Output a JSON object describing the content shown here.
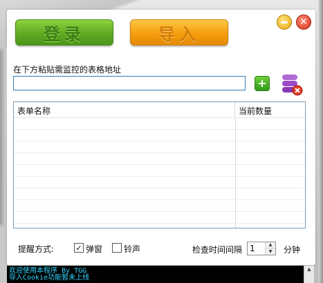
{
  "buttons": {
    "login": "登录",
    "import": "导入"
  },
  "window": {
    "minimize_icon": "minimize-icon",
    "close_icon": "close-icon",
    "close_glyph": "✕"
  },
  "url": {
    "label": "在下方粘贴需监控的表格地址",
    "value": "",
    "placeholder": "",
    "add_glyph": "+"
  },
  "table": {
    "columns": [
      "表单名称",
      "当前数量"
    ],
    "rows": []
  },
  "settings": {
    "remind_label": "提醒方式:",
    "popup_label": "弹窗",
    "popup_checked": true,
    "sound_label": "铃声",
    "sound_checked": false,
    "interval_label": "检查时间间隔",
    "interval_value": "1",
    "interval_unit": "分钟"
  },
  "console": {
    "lines": [
      "欢迎使用本程序 By TGG",
      "导入Cookie功能暂未上线"
    ]
  },
  "colors": {
    "login_green": "#5fa923",
    "import_orange": "#f39a0c",
    "console_text": "#2fd7ff"
  }
}
